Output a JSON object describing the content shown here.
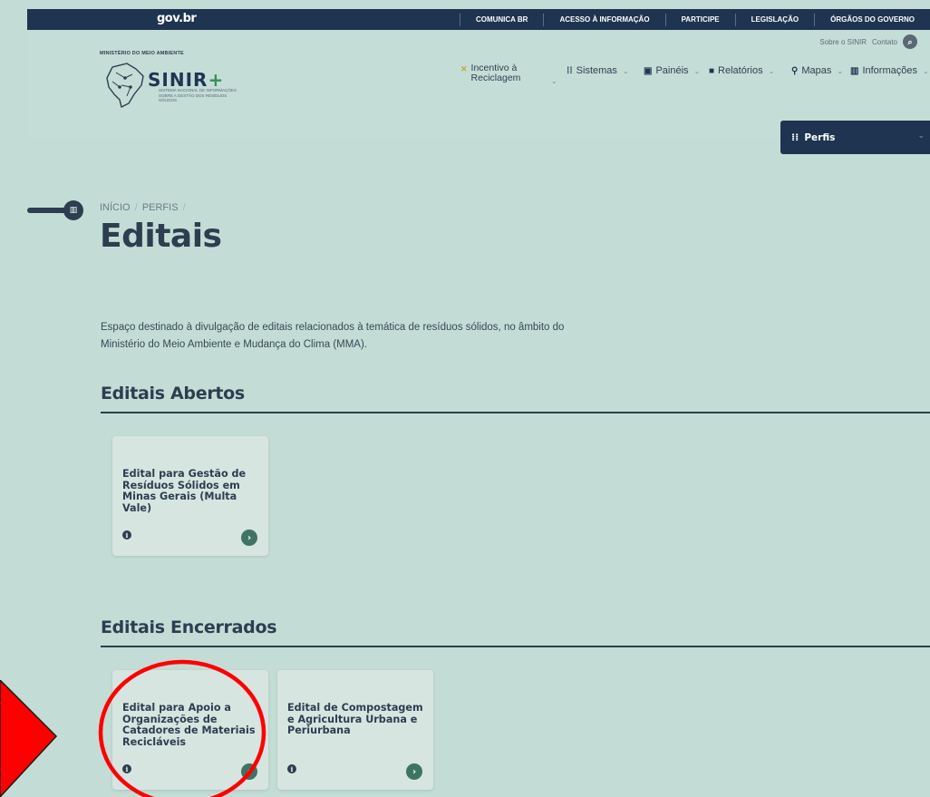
{
  "govbar": {
    "logo": "gov.br",
    "links": [
      "COMUNICA BR",
      "ACESSO À INFORMAÇÃO",
      "PARTICIPE",
      "LEGISLAÇÃO",
      "ÓRGÃOS DO GOVERNO"
    ]
  },
  "header": {
    "ministry": "MINISTÉRIO DO MEIO AMBIENTE",
    "brand_name": "SINIR",
    "brand_plus": "+",
    "brand_subtitle": "SISTEMA NACIONAL DE INFORMAÇÕES SOBRE A GESTÃO DOS RESÍDUOS SÓLIDOS",
    "utility": {
      "about": "Sobre o SINIR",
      "contact": "Contato",
      "search_icon": "search-icon"
    },
    "nav": {
      "incentivo": "Incentivo à Reciclagem",
      "sistemas": "Sistemas",
      "paineis": "Painéis",
      "relatorios": "Relatórios",
      "mapas": "Mapas",
      "informacoes": "Informações"
    },
    "perfis": "Perfis"
  },
  "breadcrumb": {
    "home": "INÍCIO",
    "sep": "/",
    "perfis": "PERFIS",
    "sep2": "/"
  },
  "page": {
    "title": "Editais",
    "intro": "Espaço destinado à divulgação de editais relacionados à temática de resíduos sólidos, no âmbito do Ministério do Meio Ambiente e Mudança do Clima (MMA)."
  },
  "sections": {
    "abertos": {
      "title": "Editais Abertos",
      "cards": [
        {
          "title": "Edital para Gestão de Resíduos Sólidos em Minas Gerais (Multa Vale)"
        }
      ]
    },
    "encerrados": {
      "title": "Editais Encerrados",
      "cards": [
        {
          "title": "Edital para Apoio a Organizações de Catadores de Materiais Recicláveis"
        },
        {
          "title": "Edital de Compostagem e Agricultura Urbana e Periurbana"
        }
      ]
    }
  },
  "icons": {
    "info": "i",
    "go": "›",
    "chevron": "⌄"
  },
  "colors": {
    "page_bg": "#c3ddd6",
    "navy": "#1e3450",
    "card_bg": "#d7e5e1",
    "go_button": "#3e7464",
    "annotation_red": "#ff0000"
  }
}
